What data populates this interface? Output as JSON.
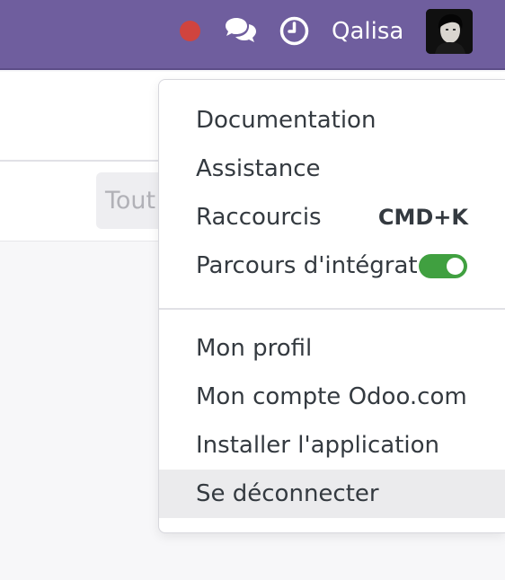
{
  "topbar": {
    "background": "#6f5e9e",
    "status_color": "#d0443e",
    "username": "Qalisa",
    "icons": {
      "status": "status-dot-icon",
      "chat": "chat-icon",
      "activity": "clock-icon",
      "avatar": "user-avatar"
    }
  },
  "control_panel": {
    "filter_button": "Tout"
  },
  "user_menu": {
    "items": [
      {
        "label": "Documentation"
      },
      {
        "label": "Assistance"
      },
      {
        "label": "Raccourcis",
        "shortcut": "CMD+K"
      },
      {
        "label": "Parcours d'intégration",
        "toggle": true
      },
      {
        "label": "Mon profil"
      },
      {
        "label": "Mon compte Odoo.com"
      },
      {
        "label": "Installer l'application"
      },
      {
        "label": "Se déconnecter",
        "highlighted": true
      }
    ],
    "toggle_color": "#40a040"
  }
}
